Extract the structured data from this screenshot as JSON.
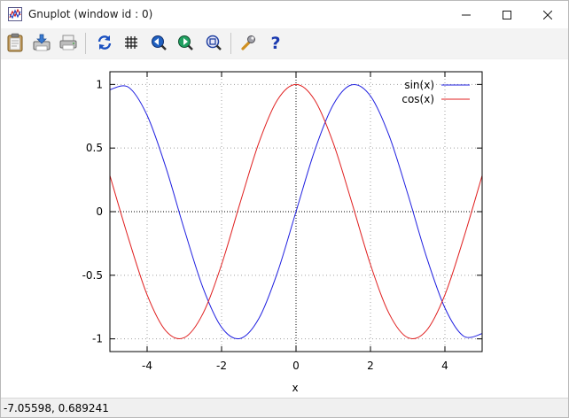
{
  "window": {
    "title": "Gnuplot (window id : 0)",
    "controls": {
      "minimize": "minimize-icon",
      "maximize": "maximize-icon",
      "close": "close-icon"
    }
  },
  "toolbar": {
    "buttons": [
      {
        "icon": "clipboard-icon"
      },
      {
        "icon": "print-icon"
      },
      {
        "icon": "printer-icon"
      },
      {
        "icon": "replot-icon"
      },
      {
        "icon": "grid-icon"
      },
      {
        "icon": "zoom-previous-icon"
      },
      {
        "icon": "zoom-next-icon"
      },
      {
        "icon": "zoom-reset-icon"
      },
      {
        "icon": "options-wrench-icon"
      },
      {
        "icon": "help-icon"
      }
    ]
  },
  "chart_data": {
    "type": "line",
    "xlabel": "x",
    "ylabel": "",
    "xlim": [
      -5,
      5
    ],
    "ylim": [
      -1.1,
      1.1
    ],
    "xticks": [
      -4,
      -2,
      0,
      2,
      4
    ],
    "yticks": [
      -1,
      -0.5,
      0,
      0.5,
      1
    ],
    "xtick_labels": [
      "-4",
      "-2",
      "0",
      "2",
      "4"
    ],
    "ytick_labels": [
      "-1",
      "-0.5",
      "0",
      "0.5",
      "1"
    ],
    "grid": true,
    "zero_axes": true,
    "legend_position": "top-right",
    "series": [
      {
        "name": "sin(x)",
        "color": "#2020e0",
        "x": [
          -5,
          -4.5,
          -4,
          -3.5,
          -3,
          -2.5,
          -2,
          -1.5,
          -1,
          -0.5,
          0,
          0.5,
          1,
          1.5,
          2,
          2.5,
          3,
          3.5,
          4,
          4.5,
          5
        ],
        "y": [
          0.959,
          0.978,
          0.757,
          0.351,
          -0.141,
          -0.598,
          -0.909,
          -0.997,
          -0.841,
          -0.479,
          0,
          0.479,
          0.841,
          0.997,
          0.909,
          0.598,
          0.141,
          -0.351,
          -0.757,
          -0.978,
          -0.959
        ]
      },
      {
        "name": "cos(x)",
        "color": "#e02020",
        "x": [
          -5,
          -4.5,
          -4,
          -3.5,
          -3,
          -2.5,
          -2,
          -1.5,
          -1,
          -0.5,
          0,
          0.5,
          1,
          1.5,
          2,
          2.5,
          3,
          3.5,
          4,
          4.5,
          5
        ],
        "y": [
          0.284,
          -0.211,
          -0.654,
          -0.936,
          -0.99,
          -0.801,
          -0.416,
          0.071,
          0.54,
          0.878,
          1,
          0.878,
          0.54,
          0.071,
          -0.416,
          -0.801,
          -0.99,
          -0.936,
          -0.654,
          -0.211,
          0.284
        ]
      }
    ]
  },
  "status": {
    "coordinates": "-7.05598,  0.689241"
  }
}
